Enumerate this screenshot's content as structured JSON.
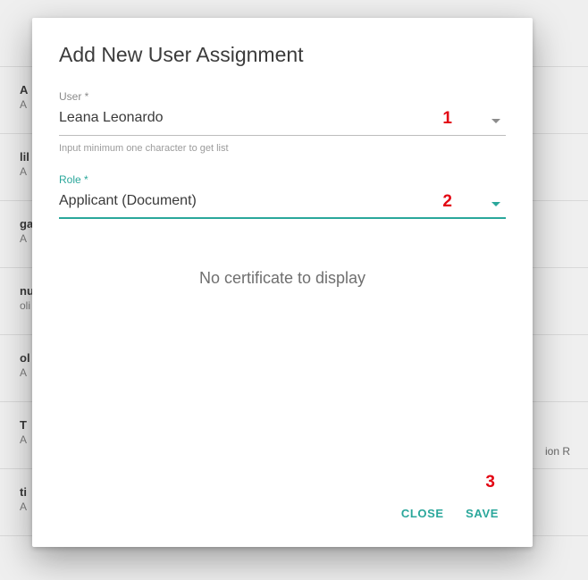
{
  "colors": {
    "accent": "#2aa79b",
    "annotation": "#e30613"
  },
  "background": {
    "rows": [
      {
        "title": "",
        "sub": ""
      },
      {
        "title": "A",
        "sub": "A"
      },
      {
        "title": "lil",
        "sub": "A"
      },
      {
        "title": "ga",
        "sub": "A"
      },
      {
        "title": "nu",
        "sub": "oli"
      },
      {
        "title": "ol",
        "sub": "A"
      },
      {
        "title": "T",
        "sub": "A"
      },
      {
        "title": "ti",
        "sub": "A"
      }
    ],
    "right_text": "ion R"
  },
  "modal": {
    "title": "Add New User Assignment",
    "user": {
      "label": "User *",
      "value": "Leana Leonardo",
      "hint": "Input minimum one character to get list"
    },
    "role": {
      "label": "Role *",
      "value": "Applicant (Document)"
    },
    "empty_message": "No certificate to display",
    "actions": {
      "close": "CLOSE",
      "save": "SAVE"
    }
  },
  "annotations": {
    "one": "1",
    "two": "2",
    "three": "3"
  }
}
